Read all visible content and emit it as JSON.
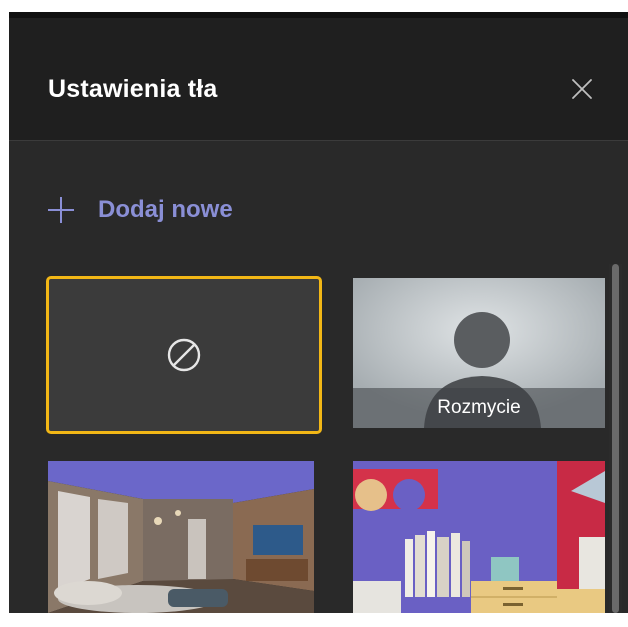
{
  "panel": {
    "title": "Ustawienia tła",
    "close_icon": "close-icon"
  },
  "actions": {
    "add_new_label": "Dodaj nowe",
    "add_new_icon": "plus-icon"
  },
  "backgrounds": [
    {
      "id": "none",
      "label": "",
      "selected": true,
      "icon": "none-icon"
    },
    {
      "id": "blur",
      "label": "Rozmycie",
      "selected": false
    },
    {
      "id": "living-room",
      "label": "",
      "selected": false
    },
    {
      "id": "bookshelf",
      "label": "",
      "selected": false
    }
  ],
  "colors": {
    "panel_bg": "#292929",
    "header_bg": "#1f1f1f",
    "accent": "#8a8fd6",
    "selected_border": "#f2b716"
  }
}
